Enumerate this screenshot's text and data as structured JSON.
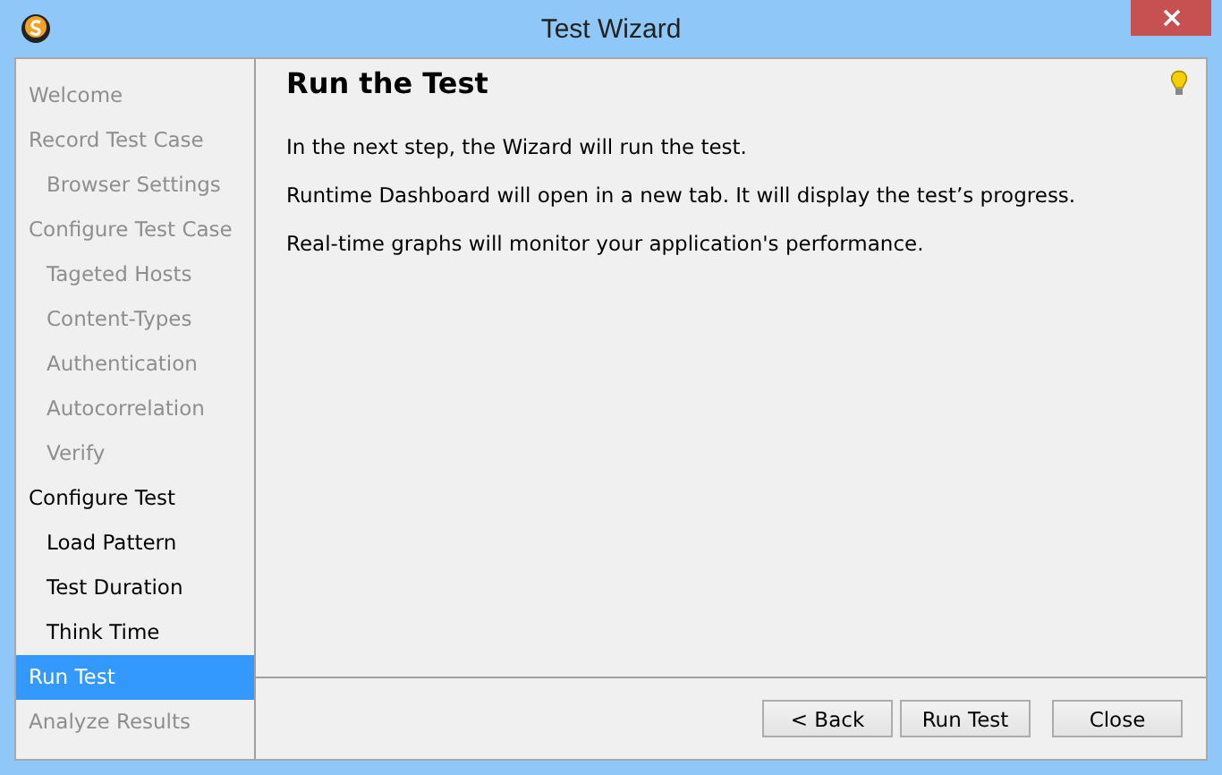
{
  "window": {
    "title": "Test Wizard"
  },
  "steps": [
    {
      "label": "Welcome",
      "disabled": true,
      "selected": false
    },
    {
      "label": "Record Test Case",
      "disabled": true,
      "selected": false,
      "children": [
        {
          "label": "Browser Settings",
          "disabled": true,
          "selected": false
        }
      ]
    },
    {
      "label": "Configure Test Case",
      "disabled": true,
      "selected": false,
      "children": [
        {
          "label": "Tageted Hosts",
          "disabled": true,
          "selected": false
        },
        {
          "label": "Content-Types",
          "disabled": true,
          "selected": false
        },
        {
          "label": "Authentication",
          "disabled": true,
          "selected": false
        },
        {
          "label": "Autocorrelation",
          "disabled": true,
          "selected": false
        },
        {
          "label": "Verify",
          "disabled": true,
          "selected": false
        }
      ]
    },
    {
      "label": "Configure Test",
      "disabled": false,
      "selected": false,
      "children": [
        {
          "label": "Load Pattern",
          "disabled": false,
          "selected": false
        },
        {
          "label": "Test Duration",
          "disabled": false,
          "selected": false
        },
        {
          "label": "Think Time",
          "disabled": false,
          "selected": false
        }
      ]
    },
    {
      "label": "Run Test",
      "disabled": false,
      "selected": true
    },
    {
      "label": "Analyze Results",
      "disabled": true,
      "selected": false
    }
  ],
  "page": {
    "heading": "Run the Test",
    "paragraphs": [
      "In the next step, the Wizard will run the test.",
      "Runtime Dashboard will open in a new tab. It will display the test’s progress.",
      "Real-time graphs will monitor your application's performance."
    ]
  },
  "buttons": [
    {
      "label": "< Back"
    },
    {
      "label": "Run Test"
    },
    {
      "label": "Close"
    }
  ]
}
